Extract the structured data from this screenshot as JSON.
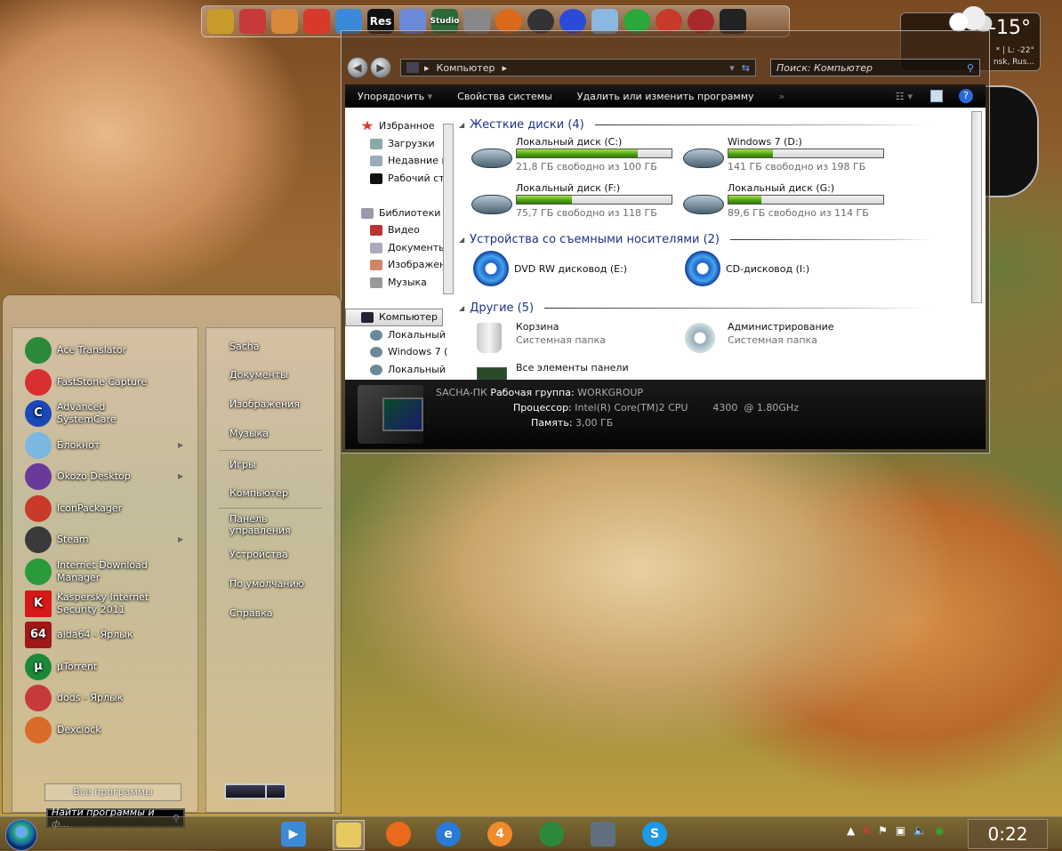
{
  "dock": {
    "icons": [
      {
        "name": "display-settings",
        "label": ""
      },
      {
        "name": "system-control",
        "label": ""
      },
      {
        "name": "paint-app",
        "label": ""
      },
      {
        "name": "ccleaner",
        "label": ""
      },
      {
        "name": "windows-logo",
        "label": ""
      },
      {
        "name": "res-hacker",
        "label": "Res"
      },
      {
        "name": "tools",
        "label": ""
      },
      {
        "name": "studio",
        "label": "Studio"
      },
      {
        "name": "robot",
        "label": ""
      },
      {
        "name": "aimp",
        "label": ""
      },
      {
        "name": "radar",
        "label": ""
      },
      {
        "name": "dvd-burner",
        "label": ""
      },
      {
        "name": "recycle-bin-glass",
        "label": ""
      },
      {
        "name": "download",
        "label": ""
      },
      {
        "name": "phoenix",
        "label": ""
      },
      {
        "name": "daemon-tools",
        "label": ""
      },
      {
        "name": "trash-bin",
        "label": ""
      }
    ]
  },
  "weather": {
    "temperature": "-15°",
    "line1": "* | L: -22°",
    "line2": "nsk, Rus..."
  },
  "explorer": {
    "address": {
      "segments": [
        "Компьютер"
      ]
    },
    "search_placeholder": "Поиск: Компьютер",
    "toolbar": {
      "organize": "Упорядочить",
      "system_properties": "Свойства системы",
      "uninstall": "Удалить или изменить программу",
      "more": "»"
    },
    "nav": {
      "favorites": {
        "label": "Избранное",
        "items": [
          "Загрузки",
          "Недавние м",
          "Рабочий ст"
        ]
      },
      "libraries": {
        "label": "Библиотеки",
        "items": [
          "Видео",
          "Документы",
          "Изображен",
          "Музыка"
        ]
      },
      "computer": {
        "label": "Компьютер",
        "items": [
          "Локальный",
          "Windows 7 (",
          "Локальный"
        ]
      }
    },
    "groups": {
      "hard_drives": {
        "title": "Жесткие диски (4)",
        "drives": [
          {
            "name": "Локальный диск (C:)",
            "free": "21,8 ГБ свободно из 100 ГБ",
            "used_fraction": 0.782
          },
          {
            "name": "Windows 7 (D:)",
            "free": "141 ГБ свободно из 198 ГБ",
            "used_fraction": 0.288
          },
          {
            "name": "Локальный диск (F:)",
            "free": "75,7 ГБ свободно из 118 ГБ",
            "used_fraction": 0.358
          },
          {
            "name": "Локальный диск (G:)",
            "free": "89,6 ГБ свободно из 114 ГБ",
            "used_fraction": 0.214
          }
        ]
      },
      "removable": {
        "title": "Устройства со съемными носителями (2)",
        "items": [
          {
            "name": "DVD RW дисковод (E:)"
          },
          {
            "name": "CD-дисковод (I:)"
          }
        ]
      },
      "other": {
        "title": "Другие (5)",
        "items": [
          {
            "name": "Корзина",
            "sub": "Системная папка"
          },
          {
            "name": "Администрирование",
            "sub": "Системная папка"
          },
          {
            "name": "Все элементы панели",
            "sub": ""
          }
        ]
      }
    },
    "details": {
      "computer_name": "SACHA-ПК",
      "workgroup_label": "Рабочая группа:",
      "workgroup": "WORKGROUP",
      "cpu_label": "Процессор:",
      "cpu": "Intel(R) Core(TM)2 CPU        4300  @ 1.80GHz",
      "memory_label": "Память:",
      "memory": "3,00 ГБ"
    }
  },
  "start_menu": {
    "programs": [
      {
        "label": "Ace Translator",
        "icon": "globe",
        "color": "#2a8a3a",
        "arrow": false
      },
      {
        "label": "FastStone Capture",
        "icon": "faststone",
        "color": "#d83030",
        "arrow": false
      },
      {
        "label": "Advanced SystemCare",
        "icon": "systemcare",
        "color": "#1a48b8",
        "arrow": false
      },
      {
        "label": "Блокнот",
        "icon": "notepad",
        "color": "#7ab8e0",
        "arrow": true
      },
      {
        "label": "Okozo Desktop",
        "icon": "okozo",
        "color": "#6a3a9a",
        "arrow": true
      },
      {
        "label": "IconPackager",
        "icon": "iconpackager",
        "color": "#c83a2a",
        "arrow": false
      },
      {
        "label": "Steam",
        "icon": "steam",
        "color": "#3a3a3a",
        "arrow": true
      },
      {
        "label": "Internet Download Manager",
        "icon": "idm",
        "color": "#2a9a3a",
        "arrow": false
      },
      {
        "label": "Kaspersky Internet Security 2011",
        "icon": "kaspersky",
        "color": "#d81818",
        "arrow": false
      },
      {
        "label": "aida64 - Ярлык",
        "icon": "aida64",
        "color": "#a01818",
        "arrow": false
      },
      {
        "label": "µTorrent",
        "icon": "utorrent",
        "color": "#1a8a3a",
        "arrow": false
      },
      {
        "label": "dods - Ярлык",
        "icon": "dods",
        "color": "#c83a3a",
        "arrow": false
      },
      {
        "label": "Dexclock",
        "icon": "dexclock",
        "color": "#d86a2a",
        "arrow": false
      }
    ],
    "all_programs": "Все программы",
    "search_placeholder": "Найти программы и ф...",
    "places": [
      "Sacha",
      "Документы",
      "Изображения",
      "Музыка",
      "Игры",
      "Компьютер",
      "Панель управления",
      "Устройства",
      "По умолчанию",
      "Справка"
    ]
  },
  "taskbar": {
    "apps": [
      {
        "name": "media-player",
        "glyph": "▶",
        "color": "#3a8ad8"
      },
      {
        "name": "explorer",
        "glyph": "",
        "color": "#e8c860",
        "active": true
      },
      {
        "name": "firefox",
        "glyph": "",
        "color": "#e86a1a"
      },
      {
        "name": "internet-explorer",
        "glyph": "e",
        "color": "#2a7ad8"
      },
      {
        "name": "aimp",
        "glyph": "4",
        "color": "#f08a2a"
      },
      {
        "name": "globe",
        "glyph": "",
        "color": "#2a8a3a"
      },
      {
        "name": "computer",
        "glyph": "",
        "color": "#607080"
      },
      {
        "name": "skype",
        "glyph": "S",
        "color": "#1a9ae8"
      }
    ],
    "tray": [
      "show-hidden-arrow",
      "kaspersky",
      "action-center-flag",
      "network",
      "volume",
      "idm"
    ],
    "time": "0:22"
  }
}
